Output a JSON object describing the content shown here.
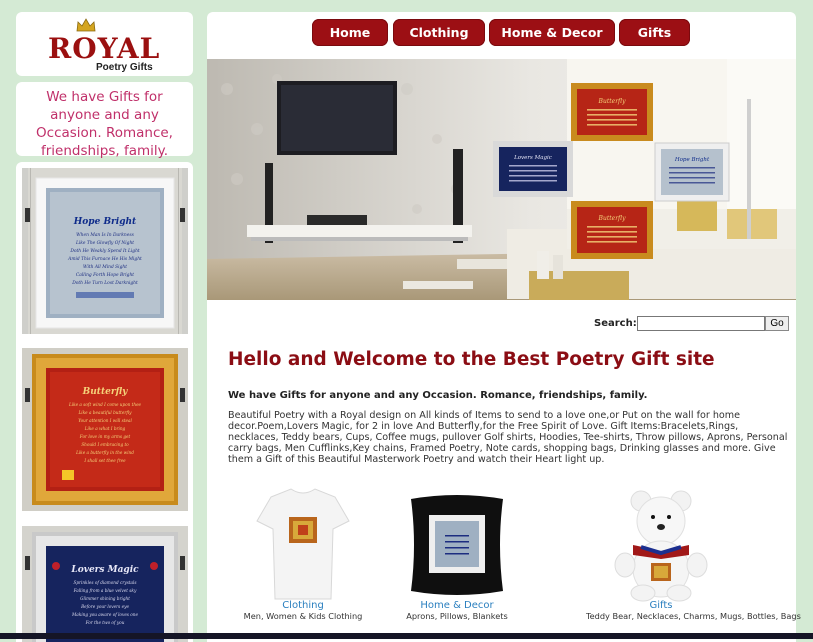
{
  "logo": {
    "word": "ROYAL",
    "sub": "Poetry Gifts"
  },
  "tagline": "We have Gifts for anyone and any Occasion. Romance, friendships, family.",
  "art": [
    {
      "title": "Hope Bright",
      "lines": [
        "When Man Is In Darkness",
        "Like The Glowfly Of Night",
        "Doth He Weakly Spend It Light",
        "Amid This Furnace He His Might",
        "With All Mind Sight",
        "Calling Forth Hope Bright",
        "Doth He Turn Lost Darknight"
      ]
    },
    {
      "title": "Butterfly",
      "lines": [
        "Like a soft wind I come upon thee",
        "Like a beautiful butterfly",
        "Your attention I will steal",
        "Like a what I bring",
        "For love in my arms get",
        "Should I embracing to",
        "Like a butterfly in the wind",
        "I shall set thee free"
      ]
    },
    {
      "title": "Lovers Magic",
      "lines": [
        "Sprinkles of diamond crystals",
        "Falling from a blue velvet sky",
        "Glimmer shining bright",
        "Before your lovers eye",
        "Making you aware of loves one",
        "For the two of you"
      ]
    }
  ],
  "nav": [
    "Home",
    "Clothing",
    "Home & Decor",
    "Gifts"
  ],
  "search": {
    "label": "Search:",
    "button": "Go",
    "value": ""
  },
  "headline": "Hello and Welcome to the Best Poetry Gift site",
  "subhead": "We have Gifts for anyone and any Occasion. Romance, friendships, family.",
  "body": "Beautiful Poetry with a Royal design on All kinds of Items to send to a love one,or Put on the wall for home decor.Poem,Lovers Magic, for 2 in love And Butterfly,for the Free Spirit of Love. Gift Items:Bracelets,Rings, necklaces, Teddy bears, Cups, Coffee mugs, pullover Golf shirts, Hoodies, Tee-shirts, Throw pillows, Aprons, Personal carry bags, Men Cufflinks,Key chains, Framed Poetry, Note cards, shopping bags, Drinking glasses and more. Give them a Gift of this Beautiful Masterwork Poetry and watch their Heart light up.",
  "products": [
    {
      "label": "Clothing",
      "desc": "Men, Women & Kids Clothing"
    },
    {
      "label": "Home & Decor",
      "desc": "Aprons, Pillows, Blankets"
    },
    {
      "label": "Gifts",
      "desc": "Teddy Bear, Necklaces, Charms, Mugs, Bottles, Bags"
    }
  ],
  "hero_frames": [
    {
      "title": "Butterfly"
    },
    {
      "title": "Lovers Magic"
    },
    {
      "title": "Hope Bright"
    },
    {
      "title": "Butterfly"
    }
  ],
  "colors": {
    "accent": "#9c0f14",
    "page_bg": "#d4ead4",
    "link": "#2a7fbf",
    "tagline": "#c0306a"
  }
}
